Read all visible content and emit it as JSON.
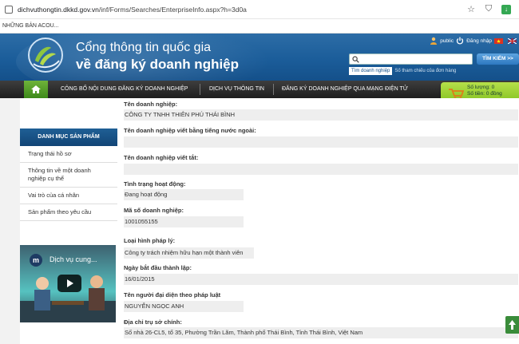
{
  "browser": {
    "url_host": "dichvuthongtin.dkkd.gov.vn",
    "url_path": "/inf/Forms/Searches/EnterpriseInfo.aspx?h=3d0a",
    "bookmark": "NHỮNG BẢN ACOU..."
  },
  "header": {
    "title_line1": "Cổng thông tin quốc gia",
    "title_line2": "về đăng ký doanh nghiệp",
    "public_label": "public",
    "login_label": "Đăng nhập",
    "search_button": "TÌM KIẾM >>",
    "search_tabs": [
      "Tìm doanh nghiệp",
      "Số tham chiếu của đơn hàng"
    ]
  },
  "nav": {
    "items": [
      "CÔNG BỐ NỘI DUNG ĐĂNG KÝ DOANH NGHIỆP",
      "DỊCH VỤ THÔNG TIN",
      "ĐĂNG KÝ DOANH NGHIỆP QUA MẠNG ĐIỆN TỬ"
    ]
  },
  "cart": {
    "quantity": "Số lượng: 0",
    "amount": "Số tiền: 0 đồng"
  },
  "sidebar": {
    "heading": "DANH MỤC SẢN PHẨM",
    "items": [
      "Trạng thái hồ sơ",
      "Thông tin về một doanh nghiệp cụ thể",
      "Vai trò của cá nhân",
      "Sản phẩm theo yêu cầu"
    ],
    "video_title": "Dịch vụ cung..."
  },
  "enterprise": {
    "name_label": "Tên doanh nghiệp:",
    "name_value": "CÔNG TY TNHH THIÊN PHÚ THÁI BÌNH",
    "foreign_label": "Tên doanh nghiệp viết bằng tiếng nước ngoài:",
    "foreign_value": "",
    "short_label": "Tên doanh nghiệp viết tắt:",
    "short_value": "",
    "status_label": "Tình trạng hoạt động:",
    "status_value": "Đang hoạt động",
    "code_label": "Mã số doanh nghiệp:",
    "code_value": "1001055155",
    "type_label": "Loại hình pháp lý:",
    "type_value": "Công ty trách nhiệm hữu hạn một thành viên",
    "date_label": "Ngày bắt đầu thành lập:",
    "date_value": "16/01/2015",
    "rep_label": "Tên người đại diện theo pháp luật",
    "rep_value": "NGUYỄN NGỌC ANH",
    "addr_label": "Địa chỉ trụ sở chính:",
    "addr_value": "Số nhà 26-CL5, tổ 35, Phường Trần Lãm, Thành phố Thái Bình, Tỉnh Thái Bình, Việt Nam"
  }
}
